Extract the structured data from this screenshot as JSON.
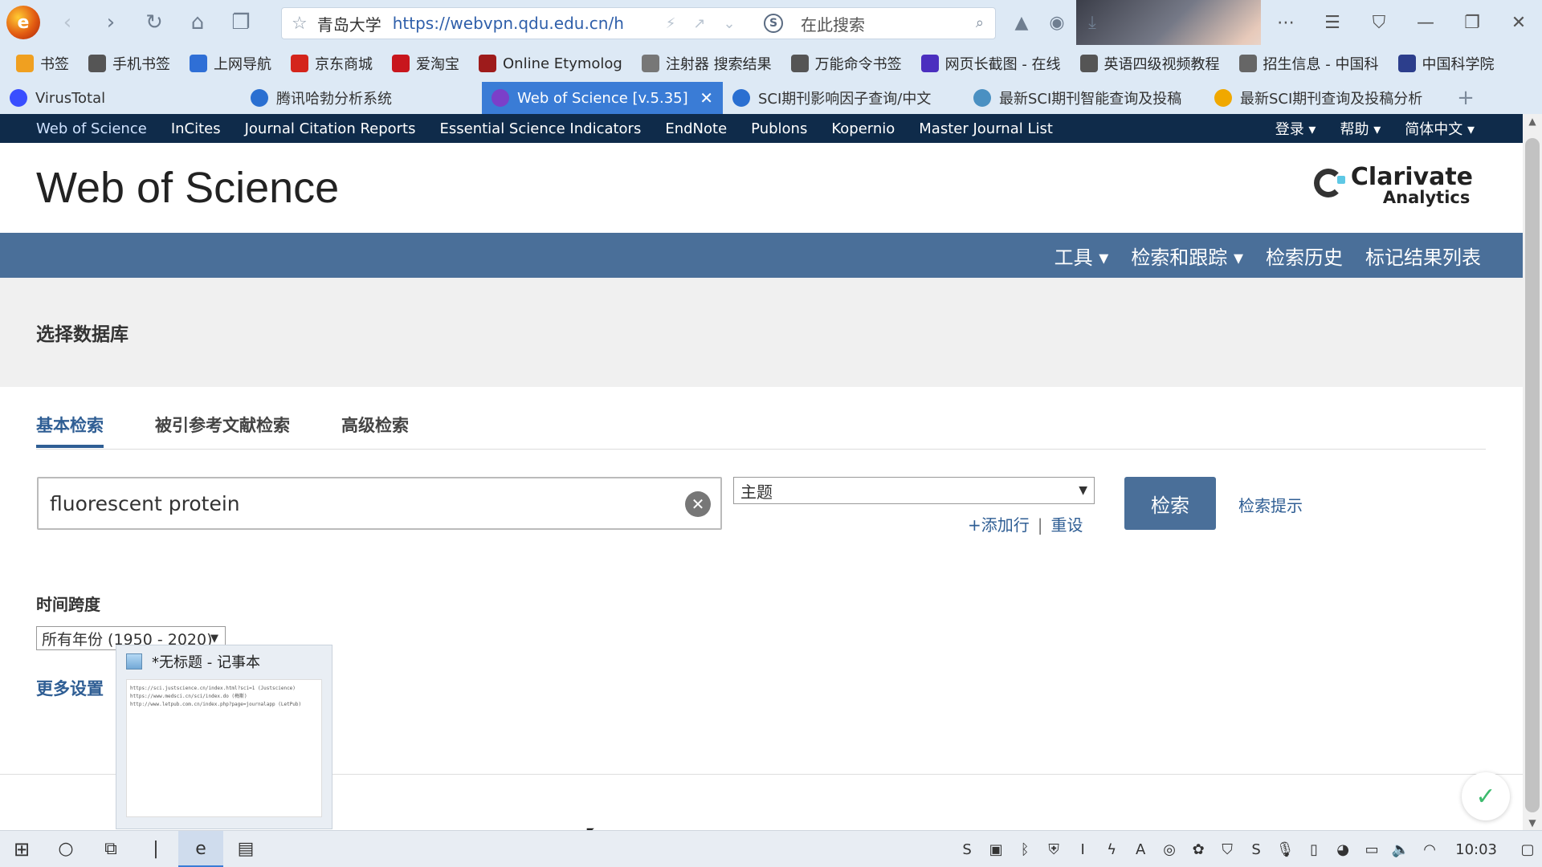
{
  "browser": {
    "address": {
      "site_name": "青岛大学",
      "url": "https://webvpn.qdu.edu.cn/h",
      "search_placeholder": "在此搜索"
    },
    "bookmarks": [
      {
        "label": "书签",
        "color": "#f0a020"
      },
      {
        "label": "手机书签",
        "color": "#555555"
      },
      {
        "label": "上网导航",
        "color": "#2f6fd6"
      },
      {
        "label": "京东商城",
        "color": "#d4251c"
      },
      {
        "label": "爱淘宝",
        "color": "#c8161d"
      },
      {
        "label": "Online Etymolog",
        "color": "#9e1b1b"
      },
      {
        "label": "注射器 搜索结果",
        "color": "#777777"
      },
      {
        "label": "万能命令书签",
        "color": "#555555"
      },
      {
        "label": "网页长截图 - 在线",
        "color": "#4b2fbf"
      },
      {
        "label": "英语四级视频教程",
        "color": "#555555"
      },
      {
        "label": "招生信息 - 中国科",
        "color": "#666666"
      },
      {
        "label": "中国科学院",
        "color": "#2c3e8c"
      }
    ],
    "tabs": [
      {
        "label": "VirusTotal",
        "active": false,
        "color": "#394eff"
      },
      {
        "label": "腾讯哈勃分析系统",
        "active": false,
        "color": "#2a6fd1"
      },
      {
        "label": "Web of Science [v.5.35]",
        "active": true,
        "color": "#7b3fc9"
      },
      {
        "label": "SCI期刊影响因子查询/中文",
        "active": false,
        "color": "#2a6fd1"
      },
      {
        "label": "最新SCI期刊智能查询及投稿",
        "active": false,
        "color": "#4a90c2"
      },
      {
        "label": "最新SCI期刊查询及投稿分析",
        "active": false,
        "color": "#f0a800"
      }
    ]
  },
  "wos": {
    "topnav": [
      "Web of Science",
      "InCites",
      "Journal Citation Reports",
      "Essential Science Indicators",
      "EndNote",
      "Publons",
      "Kopernio",
      "Master Journal List"
    ],
    "topnav_right": [
      "登录 ▾",
      "帮助 ▾",
      "简体中文 ▾"
    ],
    "brand": "Web of Science",
    "clarivate_1": "Clarivate",
    "clarivate_2": "Analytics",
    "bluebar": [
      "工具 ▾",
      "检索和跟踪 ▾",
      "检索历史",
      "标记结果列表"
    ],
    "select_db": "选择数据库",
    "search_tabs": [
      "基本检索",
      "被引参考文献检索",
      "高级检索"
    ],
    "query_value": "fluorescent protein",
    "field_value": "主题",
    "add_row": "+添加行",
    "reset": "重设",
    "search_button": "检索",
    "search_hints": "检索提示",
    "timespan_label": "时间跨度",
    "year_value": "所有年份 (1950 - 2020)",
    "more_settings": "更多设置"
  },
  "preview": {
    "title": "*无标题 - 记事本",
    "lines": [
      "https://sci.justscience.cn/index.html?sci=1       (Justscience)",
      "https://www.medsci.cn/sci/index.do                (梅斯)",
      "http://www.letpub.com.cn/index.php?page=journalapp   (LetPub)"
    ]
  },
  "taskbar": {
    "clock": "10:03"
  },
  "colors": {
    "navy": "#0f2b4a",
    "accent": "#4a6f99",
    "link": "#2f5e94",
    "active_tab": "#3a7cd6"
  }
}
